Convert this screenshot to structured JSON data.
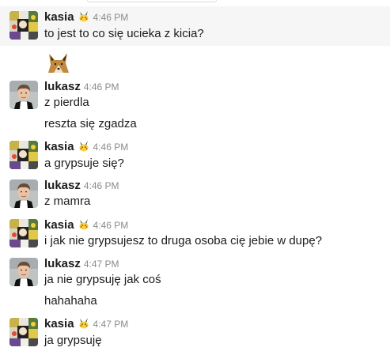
{
  "messages": [
    {
      "author": "kasia",
      "time": "4:46 PM",
      "badge_icon": "pikachu-emoji-icon",
      "lines": [
        "to jest to co się ucieka z kicia?"
      ],
      "reaction_icon": "fox-emoji-icon"
    },
    {
      "author": "lukasz",
      "time": "4:46 PM",
      "lines": [
        "z pierdla",
        "reszta się zgadza"
      ]
    },
    {
      "author": "kasia",
      "time": "4:46 PM",
      "badge_icon": "pikachu-emoji-icon",
      "lines": [
        "a grypsuje się?"
      ]
    },
    {
      "author": "lukasz",
      "time": "4:46 PM",
      "lines": [
        "z mamra"
      ]
    },
    {
      "author": "kasia",
      "time": "4:46 PM",
      "badge_icon": "pikachu-emoji-icon",
      "lines": [
        "i jak nie grypsujesz to druga osoba cię jebie w dupę?"
      ]
    },
    {
      "author": "lukasz",
      "time": "4:47 PM",
      "lines": [
        "ja nie grypsuję jak coś",
        "hahahaha"
      ]
    },
    {
      "author": "kasia",
      "time": "4:47 PM",
      "badge_icon": "pikachu-emoji-icon",
      "lines": [
        "ja grypsuję"
      ]
    }
  ],
  "colors": {
    "highlight_bg": "#f6f6f6",
    "name": "#1d1c1d",
    "time": "#8b8b8b"
  }
}
